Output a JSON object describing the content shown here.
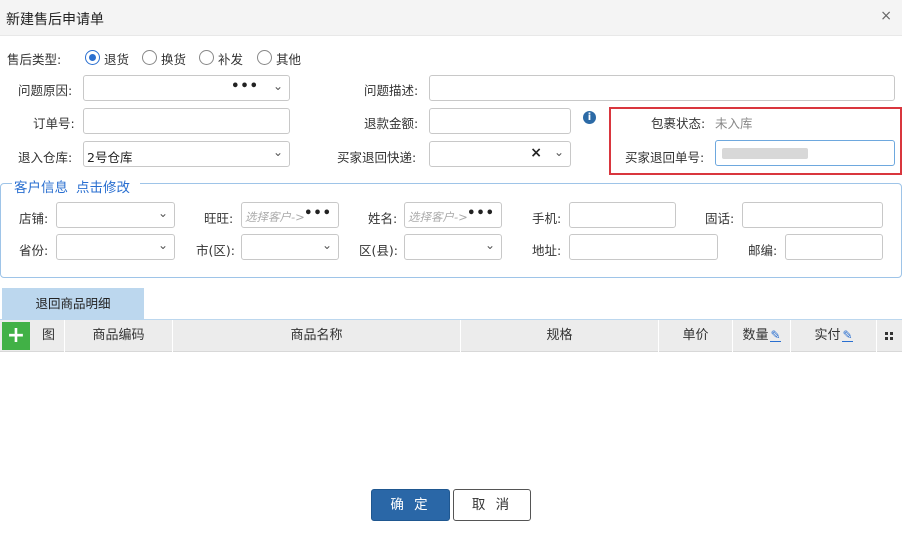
{
  "dialog": {
    "title": "新建售后申请单",
    "close_glyph": "×"
  },
  "form": {
    "type_label": "售后类型:",
    "type_options": [
      "退货",
      "换货",
      "补发",
      "其他"
    ],
    "type_selected": "退货",
    "reason_label": "问题原因:",
    "description_label": "问题描述:",
    "order_label": "订单号:",
    "refund_label": "退款金额:",
    "package_status_label": "包裹状态:",
    "package_status_value": "未入库",
    "warehouse_label": "退入仓库:",
    "warehouse_value": "2号仓库",
    "express_label": "买家退回快递:",
    "return_no_label": "买家退回单号:"
  },
  "customer": {
    "legend": "客户信息",
    "edit_link": "点击修改",
    "shop_label": "店铺:",
    "wangwang_label": "旺旺:",
    "wangwang_placeholder": "选择客户->",
    "name_label": "姓名:",
    "name_placeholder": "选择客户->",
    "phone_label": "手机:",
    "tel_label": "固话:",
    "province_label": "省份:",
    "city_label": "市(区):",
    "district_label": "区(县):",
    "address_label": "地址:",
    "zip_label": "邮编:"
  },
  "goods": {
    "tab_label": "退回商品明细",
    "add_glyph": "+",
    "columns": [
      "图",
      "商品编码",
      "商品名称",
      "规格",
      "单价",
      "数量",
      "实付"
    ]
  },
  "buttons": {
    "ok": "确 定",
    "cancel": "取 消"
  },
  "icons": {
    "chevron": "⌄",
    "dots": "•••",
    "clear": "×",
    "info": "i",
    "edit": "✎"
  },
  "colors": {
    "accent": "#2a6fd0",
    "primary_button": "#2a67a7",
    "highlight_border": "#d9363e",
    "add_button": "#41b146",
    "tab_bg": "#bcd7ee"
  }
}
